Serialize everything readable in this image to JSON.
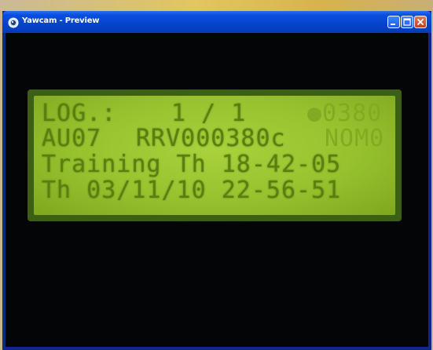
{
  "window": {
    "title": "Yawcam - Preview",
    "icon": "yawcam-app-icon",
    "controls": [
      "minimize-icon",
      "maximize-icon",
      "close-icon"
    ],
    "colors": {
      "titlebar": "#0a4fe0",
      "close_button": "#c2401f",
      "client_background": "#040507"
    }
  },
  "preview": {
    "lcd_color": "#97c22e",
    "lcd_text_color": "#5a7f10",
    "lines": [
      {
        "left": "LOG.:",
        "middle": "1 / 1",
        "right": "●0380"
      },
      {
        "left": "AU07",
        "middle": "RRV000380c",
        "right": "NOM0"
      },
      {
        "text": "Training Th 18-42-05"
      },
      {
        "text": "Th 03/11/10 22-56-51"
      }
    ]
  }
}
